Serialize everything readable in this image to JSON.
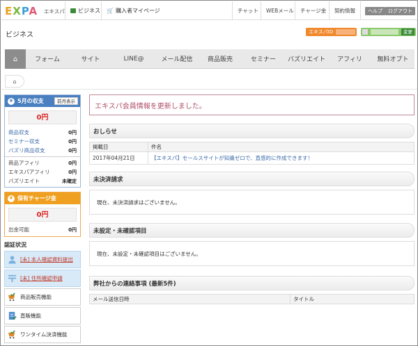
{
  "topbar": {
    "logo": {
      "e": "E",
      "x": "X",
      "p": "P",
      "a": "A"
    },
    "logo_sub": "エキスパ",
    "nav_business": "ビジネス",
    "nav_mypage": "購入者マイページ",
    "links": [
      "チャット",
      "WEBメール",
      "チャージ金",
      "契約情報"
    ],
    "help": "ヘルプ",
    "logout": "ログアウト"
  },
  "subhead": {
    "title": "ビジネス",
    "id_label": "エキスパID",
    "change": "変更"
  },
  "mainnav": {
    "home_icon": "home-icon",
    "items": [
      "フォーム",
      "サイト",
      "LINE@",
      "メール配信",
      "商品販売",
      "セミナー",
      "バズリエイト",
      "アフィリ",
      "無料オプト"
    ]
  },
  "sidebar": {
    "revenue": {
      "title": "5月の収支",
      "prev_btn": "前月表示",
      "total": "0円",
      "rows": [
        {
          "label": "商品収支",
          "value": "0円"
        },
        {
          "label": "セミナー収支",
          "value": "0円"
        },
        {
          "label": "バズリ商品収支",
          "value": "0円"
        }
      ],
      "rows2": [
        {
          "label": "商品アフィリ",
          "value": "0円"
        },
        {
          "label": "エキスパアフィリ",
          "value": "0円"
        },
        {
          "label": "バズリエイト",
          "value": "未確定"
        }
      ]
    },
    "charge": {
      "title": "保有チャージ金",
      "total": "0円",
      "row": {
        "label": "出金可能",
        "value": "0円"
      }
    },
    "auth": {
      "title": "認証状況",
      "items": [
        {
          "label": "[未] 本人確認資料提出",
          "icon": "person-icon"
        },
        {
          "label": "[未] 住所確認申請",
          "icon": "postal-icon"
        },
        {
          "label": "商品販売機能",
          "icon": "cart-check-icon"
        },
        {
          "label": "直販機能",
          "icon": "document-icon"
        },
        {
          "label": "ワンタイム決済機能",
          "icon": "cart-check-icon"
        }
      ]
    }
  },
  "main": {
    "notice": "エキスパ会員情報を更新しました。",
    "news": {
      "title": "おしらせ",
      "col_date": "掲載日",
      "col_name": "件名",
      "rows": [
        {
          "date": "2017年04月21日",
          "name": "【エキスパ】セールスサイトが知識ゼロで、直感的に作成できます！"
        }
      ]
    },
    "unpaid": {
      "title": "未決済請求",
      "message": "現在、未決済請求はございません。"
    },
    "unset": {
      "title": "未設定・未確認項目",
      "message": "現在、未設定・未確認項目はございません。"
    },
    "contact": {
      "title": "弊社からの連絡事項 (最新5件)",
      "col_date": "メール送信日時",
      "col_title": "タイトル"
    }
  },
  "colors": {
    "accent_blue": "#4a7fc0",
    "accent_orange": "#f0a020",
    "success_green": "#3a8a3a"
  }
}
